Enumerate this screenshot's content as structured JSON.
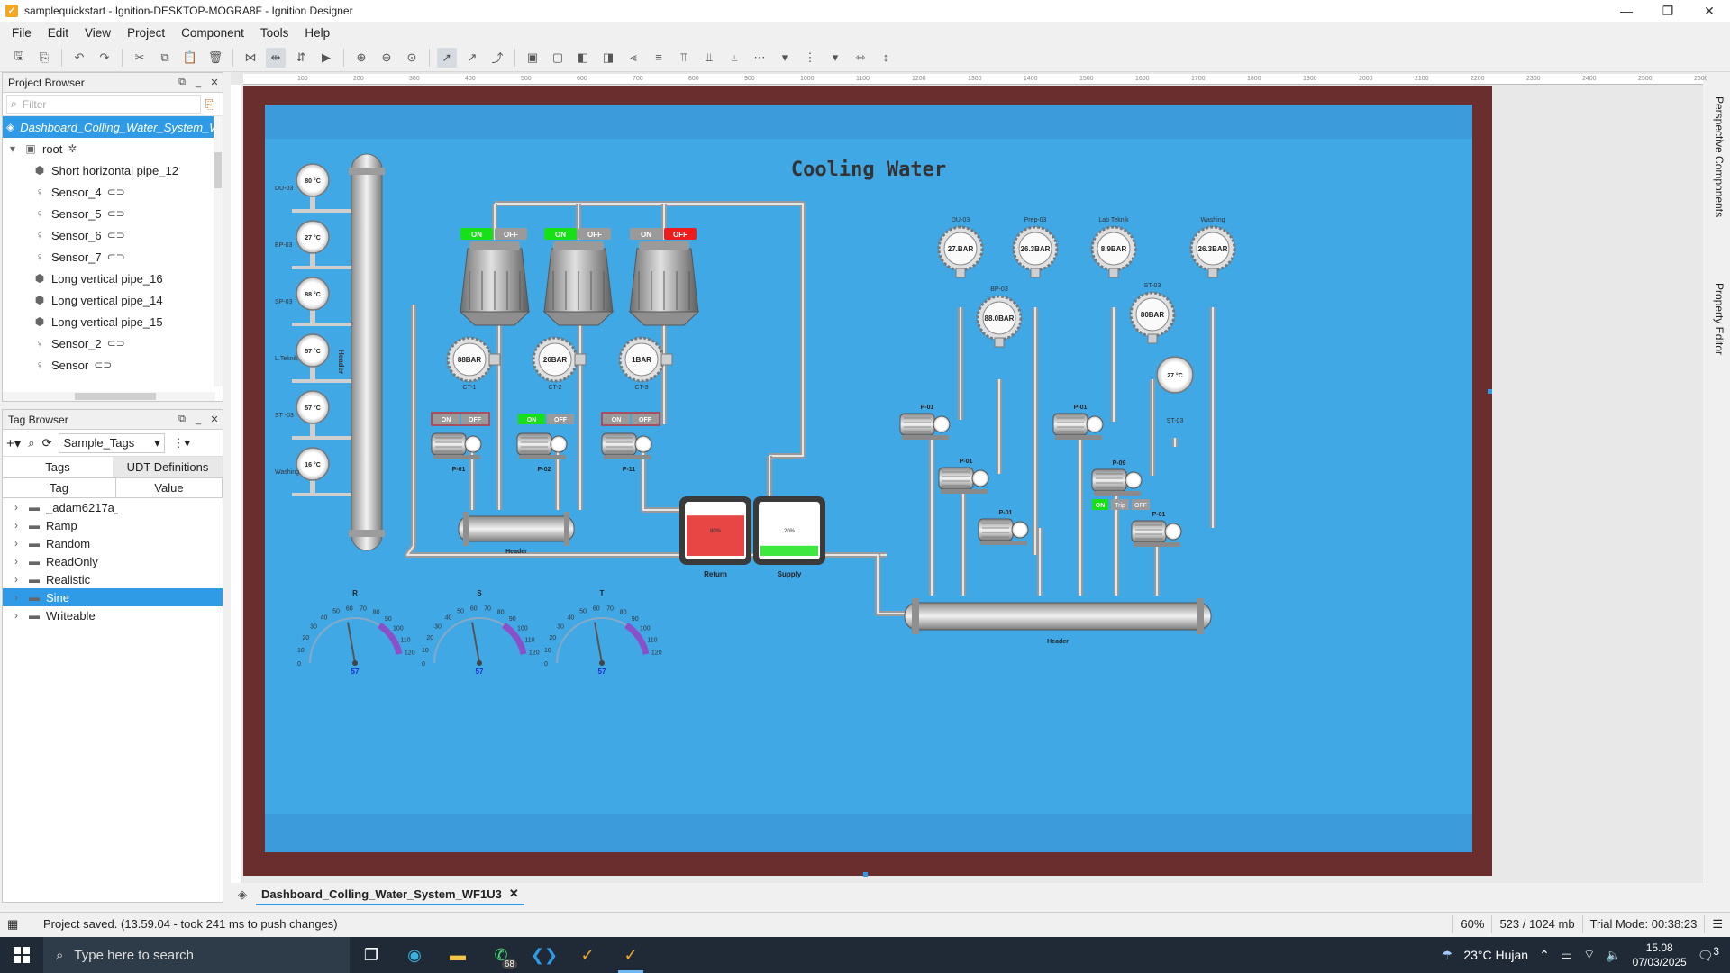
{
  "window": {
    "title": "samplequickstart - Ignition-DESKTOP-MOGRA8F - Ignition Designer"
  },
  "menu": [
    "File",
    "Edit",
    "View",
    "Project",
    "Component",
    "Tools",
    "Help"
  ],
  "project_browser": {
    "title": "Project Browser",
    "filter_placeholder": "Filter",
    "view_name": "Dashboard_Colling_Water_System_WF1U3",
    "root": "root",
    "items": [
      {
        "label": "Short horizontal pipe_12",
        "icon": "component-icon",
        "link": false
      },
      {
        "label": "Sensor_4",
        "icon": "sensor-icon",
        "link": true
      },
      {
        "label": "Sensor_5",
        "icon": "sensor-icon",
        "link": true
      },
      {
        "label": "Sensor_6",
        "icon": "sensor-icon",
        "link": true
      },
      {
        "label": "Sensor_7",
        "icon": "sensor-icon",
        "link": true
      },
      {
        "label": "Long vertical pipe_16",
        "icon": "component-icon",
        "link": false
      },
      {
        "label": "Long vertical pipe_14",
        "icon": "component-icon",
        "link": false
      },
      {
        "label": "Long vertical pipe_15",
        "icon": "component-icon",
        "link": false
      },
      {
        "label": "Sensor_2",
        "icon": "sensor-icon",
        "link": true
      },
      {
        "label": "Sensor",
        "icon": "sensor-icon",
        "link": true
      }
    ]
  },
  "tag_browser": {
    "title": "Tag Browser",
    "provider": "Sample_Tags",
    "tabs": [
      "Tags",
      "UDT Definitions"
    ],
    "columns": [
      "Tag",
      "Value"
    ],
    "folders": [
      "_adam6217a_",
      "Ramp",
      "Random",
      "ReadOnly",
      "Realistic",
      "Sine",
      "Writeable"
    ],
    "selected": "Sine"
  },
  "ruler_labels": [
    "100",
    "200",
    "300",
    "400",
    "500",
    "600",
    "700",
    "800",
    "900",
    "1000",
    "1100",
    "1200",
    "1300",
    "1400",
    "1500",
    "1600",
    "1700",
    "1800",
    "1900",
    "2000",
    "2100",
    "2200",
    "2300",
    "2400",
    "2500",
    "2600"
  ],
  "hmi": {
    "title": "Cooling Water",
    "header_label": "Header",
    "temp_sensors": [
      {
        "tag": "DU-03",
        "value": "80 °C"
      },
      {
        "tag": "BP-03",
        "value": "27 °C"
      },
      {
        "tag": "SP-03",
        "value": "88 °C"
      },
      {
        "tag": "L.Teknik",
        "value": "57 °C"
      },
      {
        "tag": "ST -03",
        "value": "57 °C"
      },
      {
        "tag": "Washing",
        "value": "16 °C"
      }
    ],
    "cooling_towers": [
      {
        "on": "ON",
        "off": "OFF",
        "state": "on"
      },
      {
        "on": "ON",
        "off": "OFF",
        "state": "on"
      },
      {
        "on": "ON",
        "off": "OFF",
        "state": "off"
      }
    ],
    "ct_gauges": [
      {
        "value": "88BAR",
        "label": "CT-1"
      },
      {
        "value": "26BAR",
        "label": "CT-2"
      },
      {
        "value": "1BAR",
        "label": "CT-3"
      }
    ],
    "pumps_left": [
      {
        "label": "P-01",
        "on": "ON",
        "off": "OFF",
        "state": "off"
      },
      {
        "label": "P-02",
        "on": "ON",
        "off": "OFF",
        "state": "on"
      },
      {
        "label": "P-11",
        "on": "ON",
        "off": "OFF",
        "state": "off"
      }
    ],
    "tanks": [
      {
        "label": "Return",
        "level_text": "80%",
        "level": 0.8,
        "color": "#e84545"
      },
      {
        "label": "Supply",
        "level_text": "20%",
        "level": 0.2,
        "color": "#3ee83e"
      }
    ],
    "pressure_gauges": [
      {
        "tag": "DU-03",
        "value": "27.BAR"
      },
      {
        "tag": "Prep-03",
        "value": "26.3BAR"
      },
      {
        "tag": "Lab Teknik",
        "value": "8.9BAR"
      },
      {
        "tag": "Washing",
        "value": "26.3BAR"
      },
      {
        "tag": "BP-03",
        "value": "88.0BAR"
      },
      {
        "tag": "ST-03",
        "value": "80BAR"
      }
    ],
    "st03_temp": {
      "value": "27 °C",
      "tag": "ST-03"
    },
    "pumps_right": [
      "P-01",
      "P-01",
      "P-01",
      "P-01",
      "P-09",
      "P-01"
    ],
    "p09_controls": {
      "on": "ON",
      "trip": "Trip",
      "off": "OFF"
    },
    "phase_gauges": [
      {
        "label": "R",
        "value": "57",
        "reading": 57
      },
      {
        "label": "S",
        "value": "57",
        "reading": 57
      },
      {
        "label": "T",
        "value": "57",
        "reading": 57
      }
    ],
    "gauge_ticks": [
      "0",
      "10",
      "20",
      "30",
      "40",
      "50",
      "60",
      "70",
      "80",
      "90",
      "100",
      "110",
      "120"
    ]
  },
  "side_tabs": [
    "Perspective Components",
    "Property Editor"
  ],
  "doc_tab": "Dashboard_Colling_Water_System_WF1U3",
  "status": {
    "message": "Project saved. (13.59.04 - took 241 ms to push changes)",
    "zoom": "60%",
    "memory": "523 / 1024 mb",
    "trial": "Trial Mode: 00:38:23"
  },
  "taskbar": {
    "search_placeholder": "Type here to search",
    "whatsapp_badge": "68",
    "weather": "23°C  Hujan",
    "time": "15.08",
    "date": "07/03/2025",
    "notifications": "3"
  }
}
